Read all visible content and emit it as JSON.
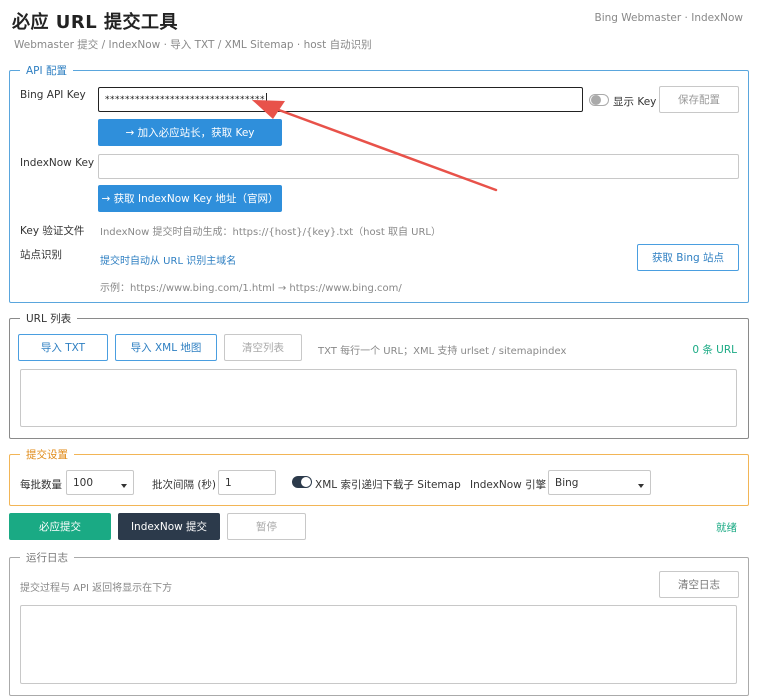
{
  "header": {
    "title": "必应 URL 提交工具",
    "subtitle": "Webmaster 提交 / IndexNow · 导入 TXT / XML Sitemap · host 自动识别",
    "brand": "Bing Webmaster · IndexNow"
  },
  "api": {
    "legend": "API 配置",
    "bing_key_label": "Bing API Key",
    "bing_key_value": "********************************",
    "show_key_label": "显示 Key",
    "save_button": "保存配置",
    "get_bing_key_button": "→ 加入必应站长，获取 Key",
    "indexnow_key_label": "IndexNow Key",
    "indexnow_key_value": "",
    "get_indexnow_key_button": "→ 获取 IndexNow Key 地址（官网）",
    "key_file_label": "Key 验证文件",
    "key_file_hint": "IndexNow 提交时自动生成：https://{host}/{key}.txt（host 取自 URL）",
    "site_detect_label": "站点识别",
    "site_detect_link": "提交时自动从 URL 识别主域名",
    "site_detect_example": "示例：https://www.bing.com/1.html → https://www.bing.com/",
    "get_bing_site_button": "获取 Bing 站点"
  },
  "url_list": {
    "legend": "URL 列表",
    "import_txt_button": "导入 TXT",
    "import_xml_button": "导入 XML 地图",
    "clear_button": "清空列表",
    "hint": "TXT 每行一个 URL；XML 支持 urlset / sitemapindex",
    "count": "0 条 URL",
    "textarea_value": ""
  },
  "submit_settings": {
    "legend": "提交设置",
    "batch_size_label": "每批数量",
    "batch_size_value": "100",
    "interval_label": "批次间隔 (秒)",
    "interval_value": "1",
    "xml_toggle_label": "XML 索引递归下载子 Sitemap",
    "engine_label": "IndexNow 引擎",
    "engine_value": "Bing"
  },
  "actions": {
    "bing_submit": "必应提交",
    "indexnow_submit": "IndexNow 提交",
    "pause": "暂停",
    "status": "就绪"
  },
  "log": {
    "legend": "运行日志",
    "hint": "提交过程与 API 返回将显示在下方",
    "clear_button": "清空日志",
    "textarea_value": ""
  },
  "colors": {
    "primary": "#2f8fdb",
    "success": "#1aaa84",
    "dark": "#2c3a4b",
    "warning": "#f2b556",
    "annotation_arrow": "#e8524a"
  }
}
